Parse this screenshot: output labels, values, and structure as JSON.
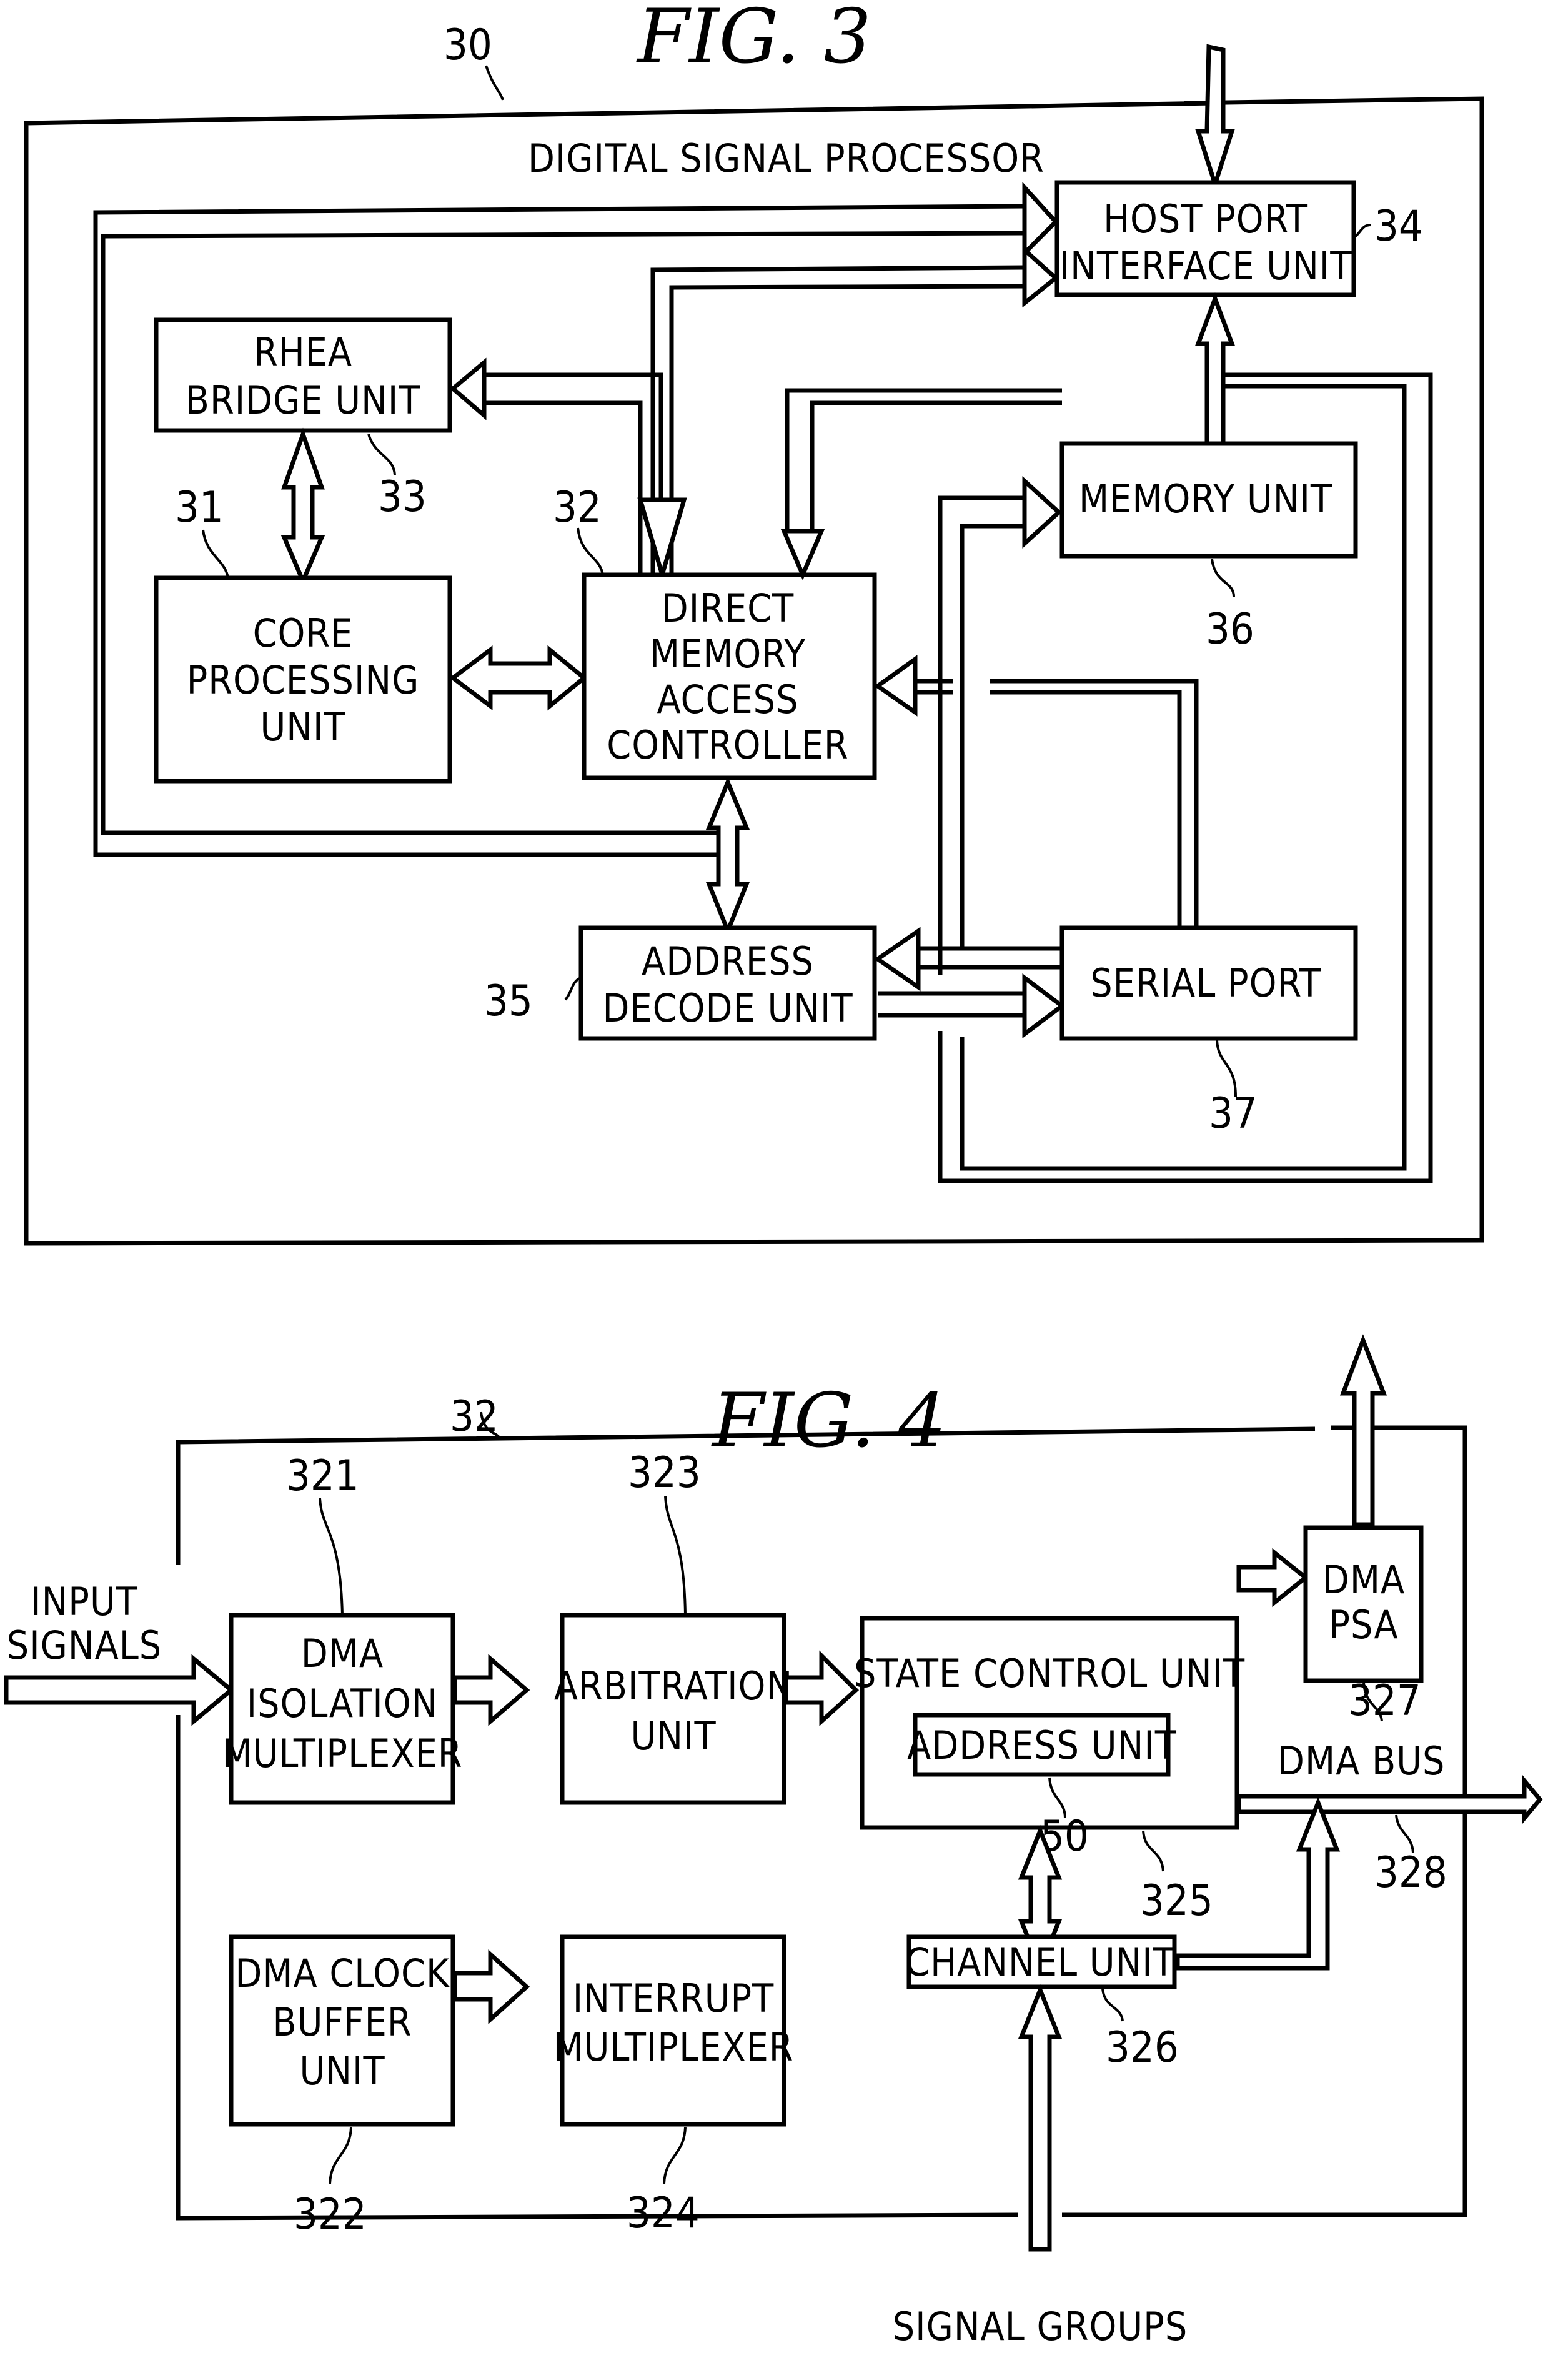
{
  "fig3": {
    "title": "FIG.  3",
    "ref_main": "30",
    "main_label": "DIGITAL SIGNAL PROCESSOR",
    "blocks": {
      "host_port": {
        "lines": [
          "HOST PORT",
          "INTERFACE UNIT"
        ],
        "ref": "34"
      },
      "rhea": {
        "lines": [
          "RHEA",
          "BRIDGE UNIT"
        ],
        "ref": "33"
      },
      "core": {
        "lines": [
          "CORE",
          "PROCESSING",
          "UNIT"
        ],
        "ref": "31"
      },
      "dma": {
        "lines": [
          "DIRECT",
          "MEMORY",
          "ACCESS",
          "CONTROLLER"
        ],
        "ref": "32"
      },
      "memory": {
        "lines": [
          "MEMORY UNIT"
        ],
        "ref": "36"
      },
      "address_decode": {
        "lines": [
          "ADDRESS",
          "DECODE UNIT"
        ],
        "ref": "35"
      },
      "serial_port": {
        "lines": [
          "SERIAL PORT"
        ],
        "ref": "37"
      }
    }
  },
  "fig4": {
    "title": "FIG.  4",
    "ref_main": "32",
    "input_label": [
      "INPUT",
      "SIGNALS"
    ],
    "signal_groups_label": "SIGNAL GROUPS",
    "dma_bus_label": "DMA BUS",
    "ref_bus": "328",
    "blocks": {
      "isolation_mux": {
        "lines": [
          "DMA",
          "ISOLATION",
          "MULTIPLEXER"
        ],
        "ref": "321"
      },
      "clock_buffer": {
        "lines": [
          "DMA CLOCK",
          "BUFFER",
          "UNIT"
        ],
        "ref": "322"
      },
      "arbitration": {
        "lines": [
          "ARBITRATION",
          "UNIT"
        ],
        "ref": "323"
      },
      "interrupt_mux": {
        "lines": [
          "INTERRUPT",
          "MULTIPLEXER"
        ],
        "ref": "324"
      },
      "state_control": {
        "lines": [
          "STATE CONTROL UNIT"
        ],
        "ref": "325"
      },
      "address_unit": {
        "lines": [
          "ADDRESS UNIT"
        ],
        "ref": "50"
      },
      "channel_unit": {
        "lines": [
          "CHANNEL UNIT"
        ],
        "ref": "326"
      },
      "dma_psa": {
        "lines": [
          "DMA",
          "PSA"
        ],
        "ref": "327"
      }
    }
  }
}
